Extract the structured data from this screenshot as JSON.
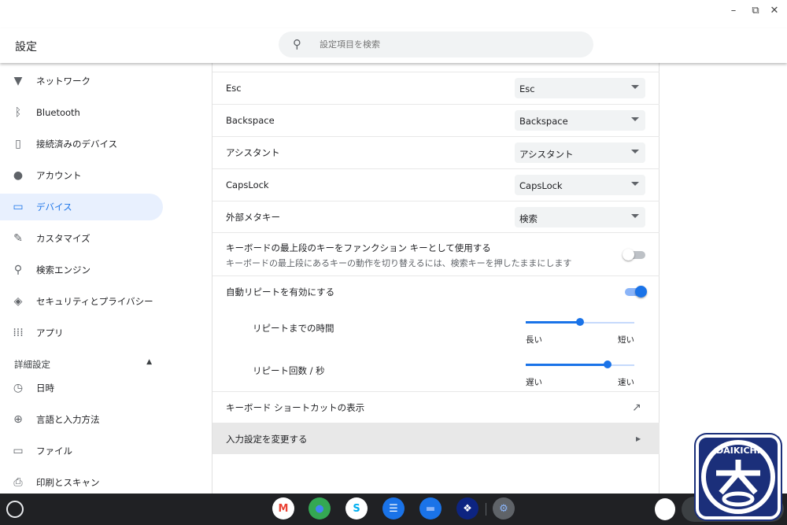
{
  "window": {
    "minimize": "–",
    "restore": "⧉",
    "close": "✕"
  },
  "header": {
    "title": "設定",
    "search_placeholder": "設定項目を検索"
  },
  "sidebar": {
    "items": [
      {
        "label": "ネットワーク",
        "icon": "wifi-icon",
        "glyph": "▼"
      },
      {
        "label": "Bluetooth",
        "icon": "bluetooth-icon",
        "glyph": "ᛒ"
      },
      {
        "label": "接続済みのデバイス",
        "icon": "phone-icon",
        "glyph": "▯"
      },
      {
        "label": "アカウント",
        "icon": "person-icon",
        "glyph": "●"
      },
      {
        "label": "デバイス",
        "icon": "laptop-icon",
        "glyph": "▭",
        "active": true
      },
      {
        "label": "カスタマイズ",
        "icon": "brush-icon",
        "glyph": "✎"
      },
      {
        "label": "検索エンジン",
        "icon": "search-icon",
        "glyph": "⚲"
      },
      {
        "label": "セキュリティとプライバシー",
        "icon": "shield-icon",
        "glyph": "◈"
      },
      {
        "label": "アプリ",
        "icon": "apps-grid-icon",
        "glyph": "⁞⁞⁞"
      }
    ],
    "advanced": "詳細設定",
    "advanced_items": [
      {
        "label": "日時",
        "icon": "clock-icon",
        "glyph": "◷"
      },
      {
        "label": "言語と入力方法",
        "icon": "globe-icon",
        "glyph": "⊕"
      },
      {
        "label": "ファイル",
        "icon": "folder-icon",
        "glyph": "▭"
      },
      {
        "label": "印刷とスキャン",
        "icon": "printer-icon",
        "glyph": "⎙"
      }
    ]
  },
  "keys": [
    {
      "label": "Esc",
      "value": "Esc"
    },
    {
      "label": "Backspace",
      "value": "Backspace"
    },
    {
      "label": "アシスタント",
      "value": "アシスタント"
    },
    {
      "label": "CapsLock",
      "value": "CapsLock"
    },
    {
      "label": "外部メタキー",
      "value": "検索"
    }
  ],
  "function_keys": {
    "label": "キーボードの最上段のキーをファンクション キーとして使用する",
    "sub": "キーボードの最上段にあるキーの動作を切り替えるには、検索キーを押したままにします",
    "on": false
  },
  "auto_repeat": {
    "label": "自動リピートを有効にする",
    "on": true
  },
  "repeat_delay": {
    "label": "リピートまでの時間",
    "min": "長い",
    "max": "短い",
    "value": 0.5
  },
  "repeat_rate": {
    "label": "リピート回数 / 秒",
    "min": "遅い",
    "max": "速い",
    "value": 0.75
  },
  "shortcuts": {
    "label": "キーボード ショートカットの表示",
    "icon": "open-external-icon"
  },
  "input": {
    "label": "入力設定を変更する"
  },
  "shelf": {
    "launcher": "○",
    "apps": [
      {
        "name": "gmail",
        "glyph": "M",
        "bg": "#ffffff",
        "fg": "#ea4335"
      },
      {
        "name": "chrome",
        "glyph": "●",
        "bg": "#34a853",
        "fg": "#4285f4"
      },
      {
        "name": "skype",
        "glyph": "S",
        "bg": "#ffffff",
        "fg": "#00aff0"
      },
      {
        "name": "messages",
        "glyph": "☰",
        "bg": "#1a73e8",
        "fg": "#ffffff"
      },
      {
        "name": "files",
        "glyph": "▬",
        "bg": "#1a73e8",
        "fg": "#8ab4f8"
      },
      {
        "name": "dropbox",
        "glyph": "❖",
        "bg": "#0d2481",
        "fg": "#ffffff"
      },
      {
        "name": "settings",
        "glyph": "⚙",
        "bg": "#5f6368",
        "fg": "#8ab4f8"
      }
    ]
  },
  "logo": {
    "text": "DAIKICHI",
    "kanji": "大吉"
  },
  "colors": {
    "accent": "#1a73e8",
    "active_bg": "#e8f0fe"
  }
}
